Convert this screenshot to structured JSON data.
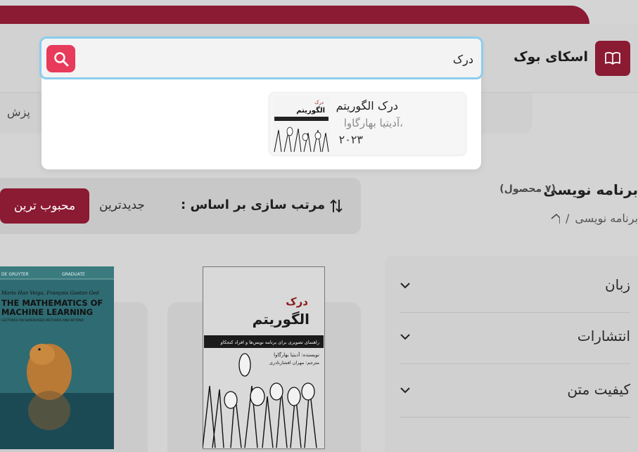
{
  "header": {
    "brand_name": "اسکای بوک",
    "nav_fragment": "پزش"
  },
  "search": {
    "value": "درک",
    "results": [
      {
        "title": "درک الگوریتم",
        "author": "،آدیتیا بهارگاوا",
        "year": "۲۰۲۳",
        "cover_top_text": "درک",
        "cover_title": "الگوریتم"
      }
    ]
  },
  "category": {
    "title": "برنامه نویسی",
    "count": "(۷ محصول)",
    "breadcrumb": "برنامه نویسی",
    "breadcrumb_sep": "/"
  },
  "sort": {
    "label": "مرتب سازی بر اساس :",
    "options": [
      "جدیدترین",
      "محبوب ترین"
    ],
    "active": "محبوب ترین"
  },
  "filters": [
    "زبان",
    "انتشارات",
    "کیفیت متن"
  ],
  "products": [
    {
      "cover_top_text": "درک",
      "cover_title": "الگوریتم",
      "cover_subtitle": "راهنمای تصویری برای برنامه نویس‌ها و افراد کنجکاو",
      "cover_author": "نویسنده: آدیتیا بهارگاوا",
      "cover_translator": "مترجم: مهران افشارنادری"
    },
    {
      "cover_publisher": "DE GRUYTER",
      "cover_series": "GRADUATE",
      "cover_authors": "Mario Han Veiga, François Gaston Ged",
      "cover_title": "THE MATHEMATICS OF MACHINE LEARNING",
      "cover_subtitle": "LECTURES ON SUPERVISED METHODS AND BEYOND"
    }
  ],
  "colors": {
    "brand": "#8b1a33",
    "search_button": "#e83a5a",
    "focus_ring": "#8ccdef"
  },
  "icons": [
    "book-icon",
    "search-icon",
    "sort-arrows-icon",
    "home-icon",
    "chevron-down-icon"
  ]
}
